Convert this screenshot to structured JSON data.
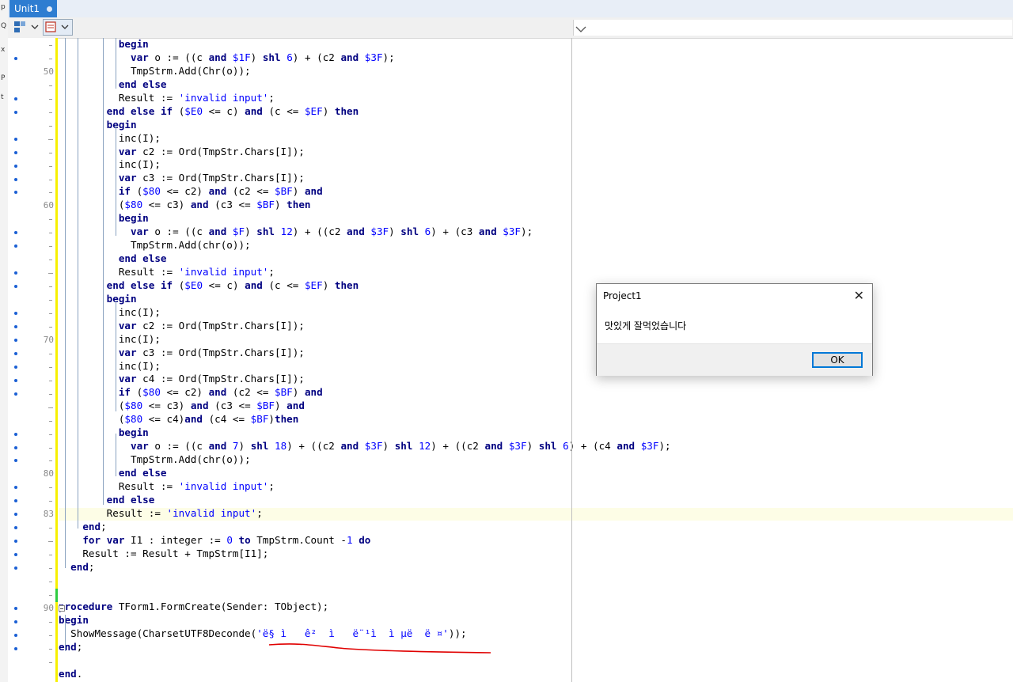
{
  "tab": {
    "label": "Unit1"
  },
  "left_panel": {
    "chars": [
      "p",
      "Q",
      "x",
      "P",
      "t"
    ]
  },
  "gutter": {
    "line_numbers": [
      "50",
      "60",
      "70",
      "80",
      "83",
      "90"
    ]
  },
  "code": {
    "lines": [
      "          begin",
      "            var o := ((c and $1F) shl 6) + (c2 and $3F);",
      "            TmpStrm.Add(Chr(o));",
      "          end else",
      "          Result := 'invalid input';",
      "        end else if ($E0 <= c) and (c <= $EF) then",
      "        begin",
      "          inc(I);",
      "          var c2 := Ord(TmpStr.Chars[I]);",
      "          inc(I);",
      "          var c3 := Ord(TmpStr.Chars[I]);",
      "          if ($80 <= c2) and (c2 <= $BF) and",
      "          ($80 <= c3) and (c3 <= $BF) then",
      "          begin",
      "            var o := ((c and $F) shl 12) + ((c2 and $3F) shl 6) + (c3 and $3F);",
      "            TmpStrm.Add(chr(o));",
      "          end else",
      "          Result := 'invalid input';",
      "        end else if ($E0 <= c) and (c <= $EF) then",
      "        begin",
      "          inc(I);",
      "          var c2 := Ord(TmpStr.Chars[I]);",
      "          inc(I);",
      "          var c3 := Ord(TmpStr.Chars[I]);",
      "          inc(I);",
      "          var c4 := Ord(TmpStr.Chars[I]);",
      "          if ($80 <= c2) and (c2 <= $BF) and",
      "          ($80 <= c3) and (c3 <= $BF) and",
      "          ($80 <= c4)and (c4 <= $BF)then",
      "          begin",
      "            var o := ((c and 7) shl 18) + ((c2 and $3F) shl 12) + ((c2 and $3F) shl 6) + (c4 and $3F);",
      "            TmpStrm.Add(chr(o));",
      "          end else",
      "          Result := 'invalid input';",
      "        end else",
      "        Result := 'invalid input';",
      "    end;",
      "    for var I1 : integer := 0 to TmpStrm.Count -1 do",
      "    Result := Result + TmpStrm[I1];",
      "  end;",
      "",
      "",
      "procedure TForm1.FormCreate(Sender: TObject);",
      "begin",
      "  ShowMessage(CharsetUTF8Deconde('ë§ ì   ê²  ì   ë¨¹ì  ì µë  ë ¤'));",
      "end;",
      "",
      "end."
    ]
  },
  "dialog": {
    "title": "Project1",
    "close": "✕",
    "message": "맛있게 잘먹었습니다",
    "ok_label": "OK"
  },
  "colors": {
    "keyword": "#000080",
    "literal": "#0000ff",
    "tab_active": "#2e7dd1",
    "change_bar": "#f7f000",
    "saved_bar": "#2ecc40",
    "annotation": "#e00000"
  }
}
